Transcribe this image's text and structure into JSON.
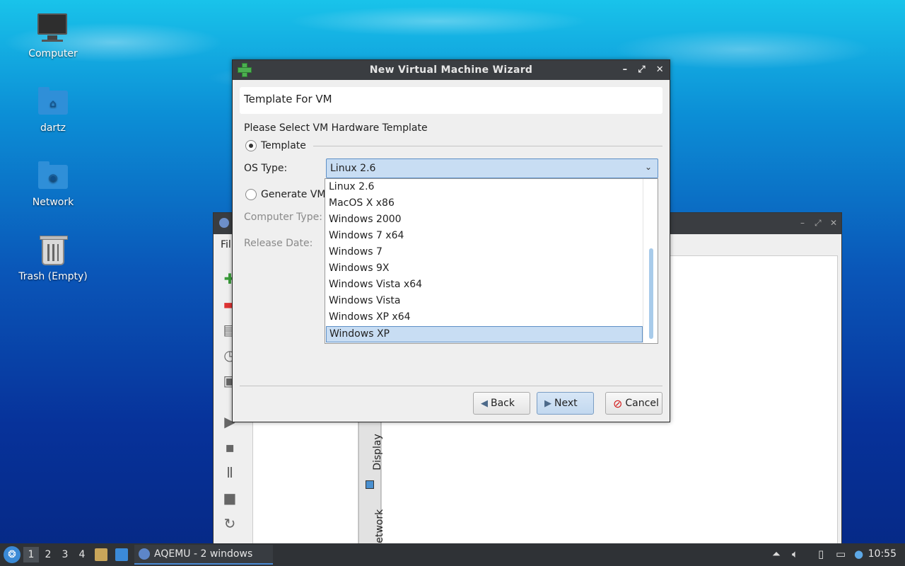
{
  "desktop": {
    "icons": [
      {
        "label": "Computer"
      },
      {
        "label": "dartz"
      },
      {
        "label": "Network"
      },
      {
        "label": "Trash (Empty)"
      }
    ]
  },
  "background_window": {
    "menu_partial": "Fil",
    "vtabs": [
      "Display",
      "Network"
    ]
  },
  "dialog": {
    "title": "New Virtual Machine Wizard",
    "title_controls": [
      "–",
      "⤢",
      "✕"
    ],
    "header": "Template For VM",
    "prompt": "Please Select VM Hardware Template",
    "radio_template": "Template",
    "os_type_label": "OS Type:",
    "os_type_value": "Linux 2.6",
    "radio_generate": "Generate VM",
    "computer_type_label": "Computer Type:",
    "release_date_label": "Release Date:",
    "buttons": {
      "back": "Back",
      "next": "Next",
      "cancel": "Cancel"
    }
  },
  "os_dropdown": {
    "options": [
      "Linux 2.6",
      "MacOS X x86",
      "Windows 2000",
      "Windows 7 x64",
      "Windows 7",
      "Windows 9X",
      "Windows Vista x64",
      "Windows Vista",
      "Windows XP x64",
      "Windows XP"
    ],
    "highlighted": "Windows XP"
  },
  "taskbar": {
    "workspaces": [
      "1",
      "2",
      "3",
      "4"
    ],
    "task_label": "AQEMU - 2 windows",
    "clock": "10:55"
  }
}
